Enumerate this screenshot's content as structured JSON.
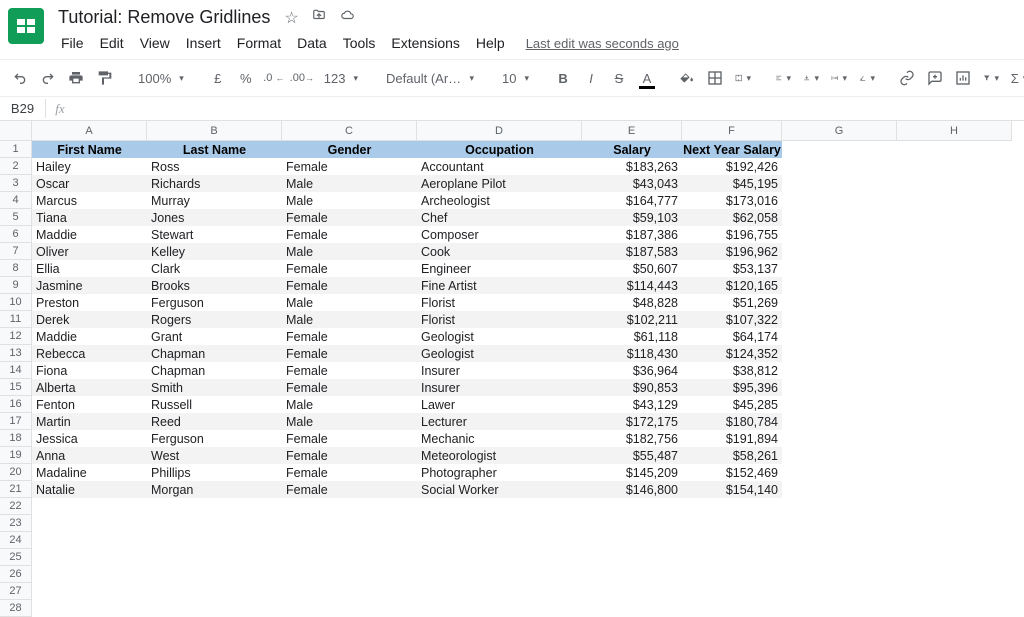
{
  "doc": {
    "title": "Tutorial: Remove Gridlines",
    "last_edit": "Last edit was seconds ago"
  },
  "menu": {
    "file": "File",
    "edit": "Edit",
    "view": "View",
    "insert": "Insert",
    "format": "Format",
    "data": "Data",
    "tools": "Tools",
    "extensions": "Extensions",
    "help": "Help"
  },
  "toolbar": {
    "zoom": "100%",
    "font": "Default (Ari...",
    "size": "10",
    "currency": "£",
    "percent": "%",
    "dec_dec": ".0",
    "inc_dec": ".00",
    "more_formats": "123"
  },
  "namebox": "B29",
  "columns": [
    "A",
    "B",
    "C",
    "D",
    "E",
    "F",
    "G",
    "H"
  ],
  "headers": {
    "a": "First Name",
    "b": "Last Name",
    "c": "Gender",
    "d": "Occupation",
    "e": "Salary",
    "f": "Next Year Salary"
  },
  "rows": [
    {
      "a": "Hailey",
      "b": "Ross",
      "c": "Female",
      "d": "Accountant",
      "e": "$183,263",
      "f": "$192,426"
    },
    {
      "a": "Oscar",
      "b": "Richards",
      "c": "Male",
      "d": "Aeroplane Pilot",
      "e": "$43,043",
      "f": "$45,195"
    },
    {
      "a": "Marcus",
      "b": "Murray",
      "c": "Male",
      "d": "Archeologist",
      "e": "$164,777",
      "f": "$173,016"
    },
    {
      "a": "Tiana",
      "b": "Jones",
      "c": "Female",
      "d": "Chef",
      "e": "$59,103",
      "f": "$62,058"
    },
    {
      "a": "Maddie",
      "b": "Stewart",
      "c": "Female",
      "d": "Composer",
      "e": "$187,386",
      "f": "$196,755"
    },
    {
      "a": "Oliver",
      "b": "Kelley",
      "c": "Male",
      "d": "Cook",
      "e": "$187,583",
      "f": "$196,962"
    },
    {
      "a": "Ellia",
      "b": "Clark",
      "c": "Female",
      "d": "Engineer",
      "e": "$50,607",
      "f": "$53,137"
    },
    {
      "a": "Jasmine",
      "b": "Brooks",
      "c": "Female",
      "d": "Fine Artist",
      "e": "$114,443",
      "f": "$120,165"
    },
    {
      "a": "Preston",
      "b": "Ferguson",
      "c": "Male",
      "d": "Florist",
      "e": "$48,828",
      "f": "$51,269"
    },
    {
      "a": "Derek",
      "b": "Rogers",
      "c": "Male",
      "d": "Florist",
      "e": "$102,211",
      "f": "$107,322"
    },
    {
      "a": "Maddie",
      "b": "Grant",
      "c": "Female",
      "d": "Geologist",
      "e": "$61,118",
      "f": "$64,174"
    },
    {
      "a": "Rebecca",
      "b": "Chapman",
      "c": "Female",
      "d": "Geologist",
      "e": "$118,430",
      "f": "$124,352"
    },
    {
      "a": "Fiona",
      "b": "Chapman",
      "c": "Female",
      "d": "Insurer",
      "e": "$36,964",
      "f": "$38,812"
    },
    {
      "a": "Alberta",
      "b": "Smith",
      "c": "Female",
      "d": "Insurer",
      "e": "$90,853",
      "f": "$95,396"
    },
    {
      "a": "Fenton",
      "b": "Russell",
      "c": "Male",
      "d": "Lawer",
      "e": "$43,129",
      "f": "$45,285"
    },
    {
      "a": "Martin",
      "b": "Reed",
      "c": "Male",
      "d": "Lecturer",
      "e": "$172,175",
      "f": "$180,784"
    },
    {
      "a": "Jessica",
      "b": "Ferguson",
      "c": "Female",
      "d": "Mechanic",
      "e": "$182,756",
      "f": "$191,894"
    },
    {
      "a": "Anna",
      "b": "West",
      "c": "Female",
      "d": "Meteorologist",
      "e": "$55,487",
      "f": "$58,261"
    },
    {
      "a": "Madaline",
      "b": "Phillips",
      "c": "Female",
      "d": "Photographer",
      "e": "$145,209",
      "f": "$152,469"
    },
    {
      "a": "Natalie",
      "b": "Morgan",
      "c": "Female",
      "d": "Social Worker",
      "e": "$146,800",
      "f": "$154,140"
    }
  ],
  "empty_rows": 7
}
